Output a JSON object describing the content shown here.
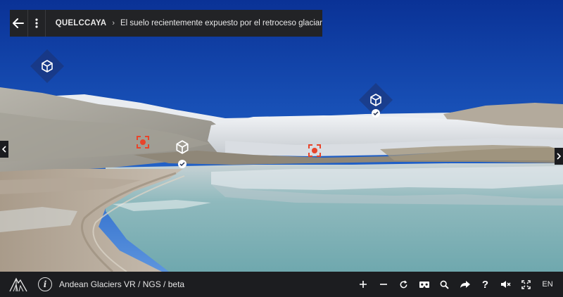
{
  "topbar": {
    "back_icon": "arrow-left-icon",
    "menu_icon": "vertical-dots-icon",
    "location": "QUELCCAYA",
    "separator": "›",
    "scene_title": "El suelo recientemente expuesto por el retroceso glaciar"
  },
  "hotspots": {
    "cube_icon": "cube-icon",
    "visited_icon": "check-icon",
    "info_point_icon": "target-icon"
  },
  "footer": {
    "credit": "Andean Glaciers VR / NGS / beta",
    "info_label": "i",
    "language": "EN",
    "tools": [
      {
        "name": "zoom-in",
        "label": "+"
      },
      {
        "name": "zoom-out",
        "label": "−"
      },
      {
        "name": "refresh",
        "label": "↻"
      },
      {
        "name": "vr-headset",
        "label": "VR"
      },
      {
        "name": "search",
        "label": "⚲"
      },
      {
        "name": "share",
        "label": "➦"
      },
      {
        "name": "help",
        "label": "?"
      },
      {
        "name": "mute",
        "label": "🔇"
      },
      {
        "name": "fullscreen",
        "label": "⛶"
      }
    ]
  },
  "colors": {
    "sky_top": "#0a3aa6",
    "sky_bottom": "#3f7ed8",
    "bar_bg": "#222326",
    "target_red": "#e8442a"
  }
}
